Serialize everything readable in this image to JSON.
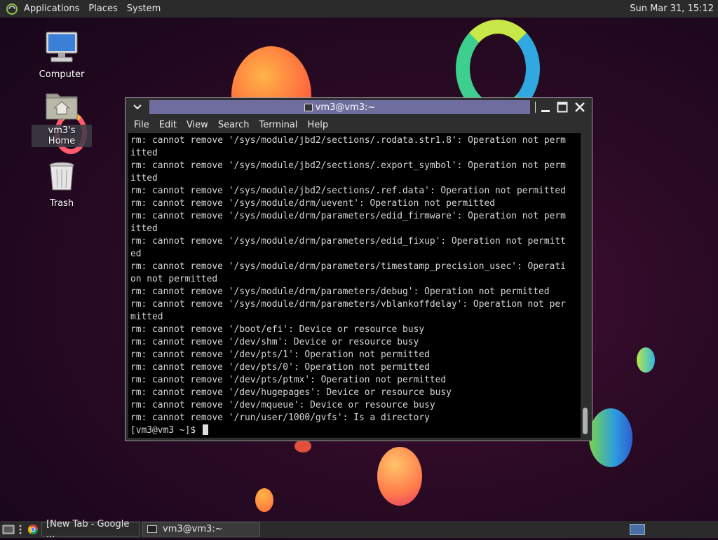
{
  "top_panel": {
    "menus": [
      "Applications",
      "Places",
      "System"
    ],
    "clock": "Sun Mar 31, 15:12"
  },
  "desktop": {
    "icons": [
      {
        "label": "Computer",
        "icon": "computer-icon"
      },
      {
        "label": "vm3's Home",
        "icon": "home-folder-icon"
      },
      {
        "label": "Trash",
        "icon": "trash-icon"
      }
    ]
  },
  "window": {
    "title": "vm3@vm3:~",
    "menus": [
      "File",
      "Edit",
      "View",
      "Search",
      "Terminal",
      "Help"
    ]
  },
  "terminal": {
    "lines": [
      "rm: cannot remove '/sys/module/jbd2/sections/.rodata.str1.8': Operation not perm",
      "itted",
      "rm: cannot remove '/sys/module/jbd2/sections/.export_symbol': Operation not perm",
      "itted",
      "rm: cannot remove '/sys/module/jbd2/sections/.ref.data': Operation not permitted",
      "rm: cannot remove '/sys/module/drm/uevent': Operation not permitted",
      "rm: cannot remove '/sys/module/drm/parameters/edid_firmware': Operation not perm",
      "itted",
      "rm: cannot remove '/sys/module/drm/parameters/edid_fixup': Operation not permitt",
      "ed",
      "rm: cannot remove '/sys/module/drm/parameters/timestamp_precision_usec': Operati",
      "on not permitted",
      "rm: cannot remove '/sys/module/drm/parameters/debug': Operation not permitted",
      "rm: cannot remove '/sys/module/drm/parameters/vblankoffdelay': Operation not per",
      "mitted",
      "rm: cannot remove '/boot/efi': Device or resource busy",
      "rm: cannot remove '/dev/shm': Device or resource busy",
      "rm: cannot remove '/dev/pts/1': Operation not permitted",
      "rm: cannot remove '/dev/pts/0': Operation not permitted",
      "rm: cannot remove '/dev/pts/ptmx': Operation not permitted",
      "rm: cannot remove '/dev/hugepages': Device or resource busy",
      "rm: cannot remove '/dev/mqueue': Device or resource busy",
      "rm: cannot remove '/run/user/1000/gvfs': Is a directory"
    ],
    "prompt": "[vm3@vm3 ~]$ "
  },
  "taskbar": {
    "tasks": [
      {
        "label": "[New Tab - Google ...",
        "icon": "chrome-icon"
      },
      {
        "label": "vm3@vm3:~",
        "icon": "terminal-icon"
      }
    ]
  },
  "colors": {
    "panel": "#2b2b2b",
    "title_active": "#6f6d9e",
    "terminal_bg": "#000000",
    "terminal_fg": "#d6d6d6"
  }
}
